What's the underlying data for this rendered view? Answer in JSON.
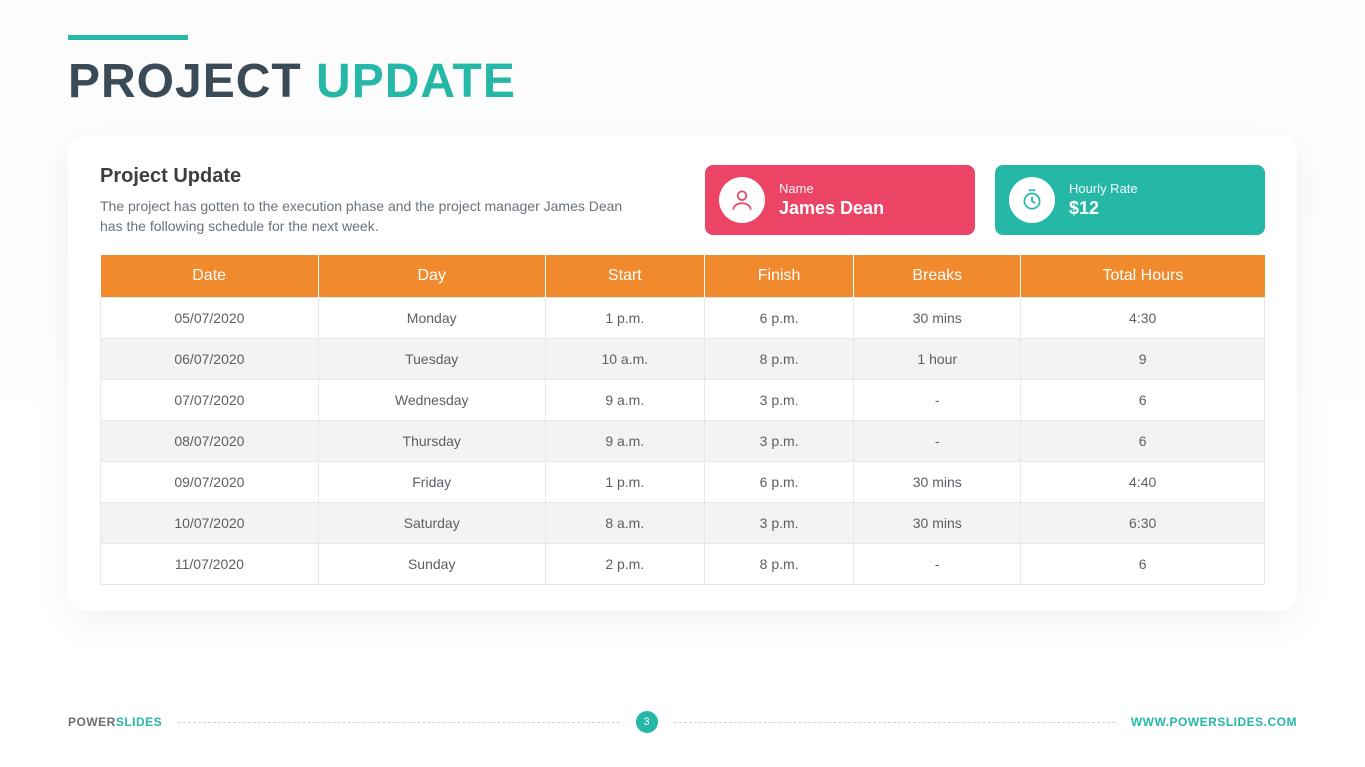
{
  "title_part1": "PROJECT ",
  "title_part2": "UPDATE",
  "summary": {
    "heading": "Project Update",
    "text": "The project has gotten to the execution phase and the project manager James Dean has the following schedule for the next week."
  },
  "name_pill": {
    "label": "Name",
    "value": "James Dean"
  },
  "rate_pill": {
    "label": "Hourly Rate",
    "value": "$12"
  },
  "table": {
    "headers": [
      "Date",
      "Day",
      "Start",
      "Finish",
      "Breaks",
      "Total Hours"
    ],
    "rows": [
      [
        "05/07/2020",
        "Monday",
        "1 p.m.",
        "6 p.m.",
        "30 mins",
        "4:30"
      ],
      [
        "06/07/2020",
        "Tuesday",
        "10 a.m.",
        "8 p.m.",
        "1 hour",
        "9"
      ],
      [
        "07/07/2020",
        "Wednesday",
        "9 a.m.",
        "3 p.m.",
        "-",
        "6"
      ],
      [
        "08/07/2020",
        "Thursday",
        "9 a.m.",
        "3 p.m.",
        "-",
        "6"
      ],
      [
        "09/07/2020",
        "Friday",
        "1 p.m.",
        "6 p.m.",
        "30 mins",
        "4:40"
      ],
      [
        "10/07/2020",
        "Saturday",
        "8 a.m.",
        "3 p.m.",
        "30 mins",
        "6:30"
      ],
      [
        "11/07/2020",
        "Sunday",
        "2 p.m.",
        "8 p.m.",
        "-",
        "6"
      ]
    ]
  },
  "footer": {
    "brand1": "POWER",
    "brand2": "SLIDES",
    "page": "3",
    "url": "WWW.POWERSLIDES.COM"
  },
  "colors": {
    "teal": "#26b8a6",
    "orange": "#f08a2c",
    "pink": "#eb4464"
  }
}
